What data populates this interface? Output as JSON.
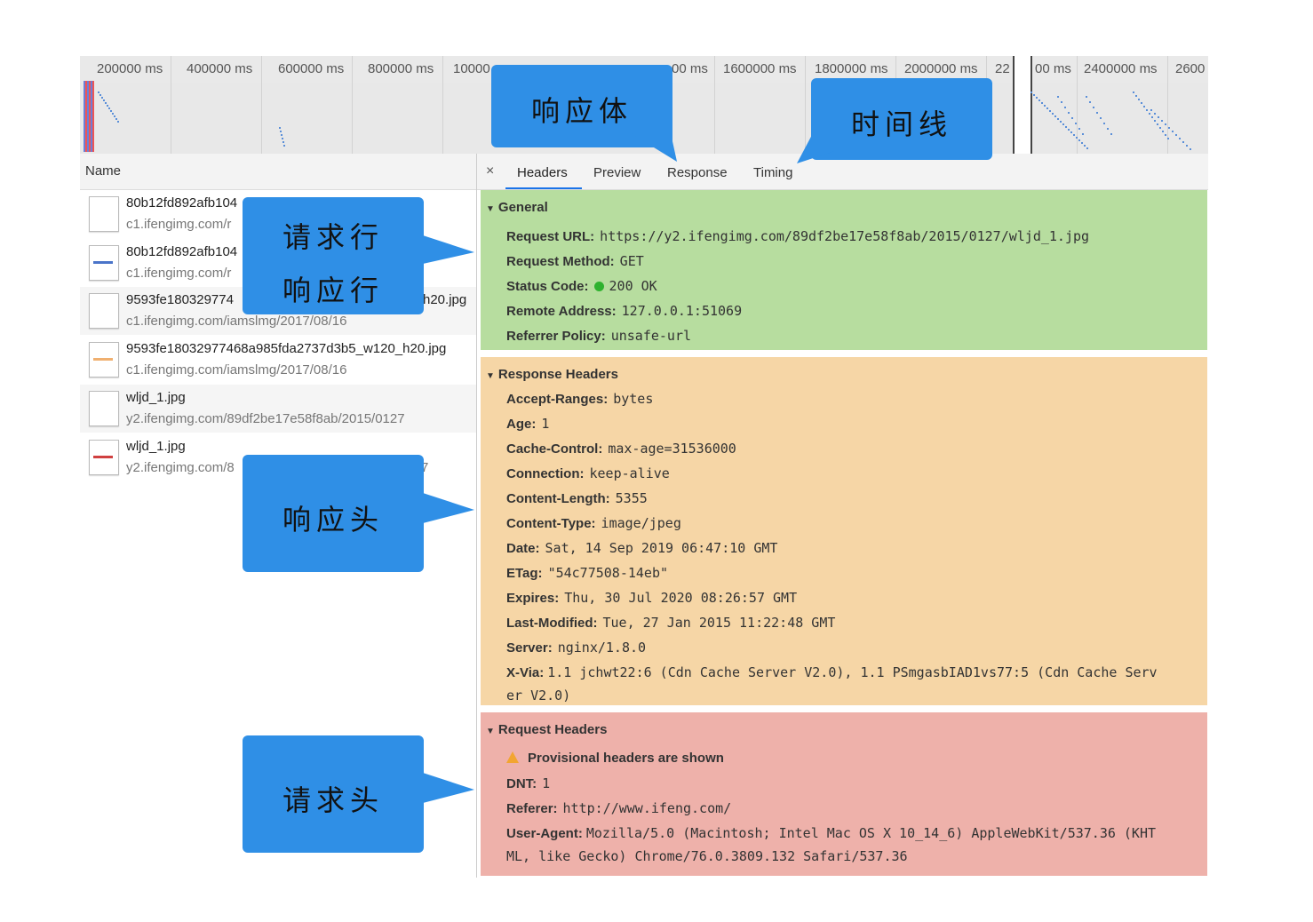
{
  "overview": {
    "ticks": [
      "200000 ms",
      "400000 ms",
      "600000 ms",
      "800000 ms",
      "10000",
      "00 ms",
      "1600000 ms",
      "1800000 ms",
      "2000000 ms",
      "22",
      "0",
      "00 ms",
      "2400000 ms",
      "2600"
    ]
  },
  "list": {
    "header": "Name",
    "rows": [
      {
        "name": "80b12fd892afb104",
        "path": "c1.ifengimg.com/r",
        "mark": "#ffffff"
      },
      {
        "name": "80b12fd892afb104",
        "path": "c1.ifengimg.com/r",
        "mark": "#4a74c9"
      },
      {
        "name": "9593fe180329774",
        "name_tail": "h20.jpg",
        "path": "c1.ifengimg.com/iamslmg/2017/08/16",
        "mark": "#ffffff"
      },
      {
        "name": "9593fe18032977468a985fda2737d3b5_w120_h20.jpg",
        "path": "c1.ifengimg.com/iamslmg/2017/08/16",
        "mark": "#f0b070"
      },
      {
        "name": "wljd_1.jpg",
        "path": "y2.ifengimg.com/89df2be17e58f8ab/2015/0127",
        "mark": "#ffffff"
      },
      {
        "name": "wljd_1.jpg",
        "path": "y2.ifengimg.com/8",
        "path_tail": "7",
        "mark": "#d04040"
      }
    ]
  },
  "tabs": {
    "close": "×",
    "items": [
      "Headers",
      "Preview",
      "Response",
      "Timing"
    ]
  },
  "general": {
    "title": "General",
    "fields": [
      {
        "k": "Request URL:",
        "v": "https://y2.ifengimg.com/89df2be17e58f8ab/2015/0127/wljd_1.jpg"
      },
      {
        "k": "Request Method:",
        "v": "GET"
      },
      {
        "k": "Status Code:",
        "v": "200 OK"
      },
      {
        "k": "Remote Address:",
        "v": "127.0.0.1:51069"
      },
      {
        "k": "Referrer Policy:",
        "v": "unsafe-url"
      }
    ]
  },
  "response_headers": {
    "title": "Response Headers",
    "fields": [
      {
        "k": "Accept-Ranges:",
        "v": "bytes"
      },
      {
        "k": "Age:",
        "v": "1"
      },
      {
        "k": "Cache-Control:",
        "v": "max-age=31536000"
      },
      {
        "k": "Connection:",
        "v": "keep-alive"
      },
      {
        "k": "Content-Length:",
        "v": "5355"
      },
      {
        "k": "Content-Type:",
        "v": "image/jpeg"
      },
      {
        "k": "Date:",
        "v": "Sat, 14 Sep 2019 06:47:10 GMT"
      },
      {
        "k": "ETag:",
        "v": "\"54c77508-14eb\""
      },
      {
        "k": "Expires:",
        "v": "Thu, 30 Jul 2020 08:26:57 GMT"
      },
      {
        "k": "Last-Modified:",
        "v": "Tue, 27 Jan 2015 11:22:48 GMT"
      },
      {
        "k": "Server:",
        "v": "nginx/1.8.0"
      },
      {
        "k": "X-Via:",
        "v": "1.1 jchwt22:6 (Cdn Cache Server V2.0), 1.1 PSmgasbIAD1vs77:5 (Cdn Cache Serv",
        "v2": "er V2.0)"
      }
    ]
  },
  "request_headers": {
    "title": "Request Headers",
    "warning": "Provisional headers are shown",
    "fields": [
      {
        "k": "DNT:",
        "v": "1"
      },
      {
        "k": "Referer:",
        "v": "http://www.ifeng.com/"
      },
      {
        "k": "User-Agent:",
        "v": "Mozilla/5.0 (Macintosh; Intel Mac OS X 10_14_6) AppleWebKit/537.36 (KHT",
        "v2": "ML, like Gecko) Chrome/76.0.3809.132 Safari/537.36"
      }
    ]
  },
  "callouts": {
    "response_body": "响应体",
    "timeline": "时间线",
    "request_line": "请求行",
    "response_line": "响应行",
    "response_headers": "响应头",
    "request_headers": "请求头",
    "color": "#2f8fe6"
  }
}
